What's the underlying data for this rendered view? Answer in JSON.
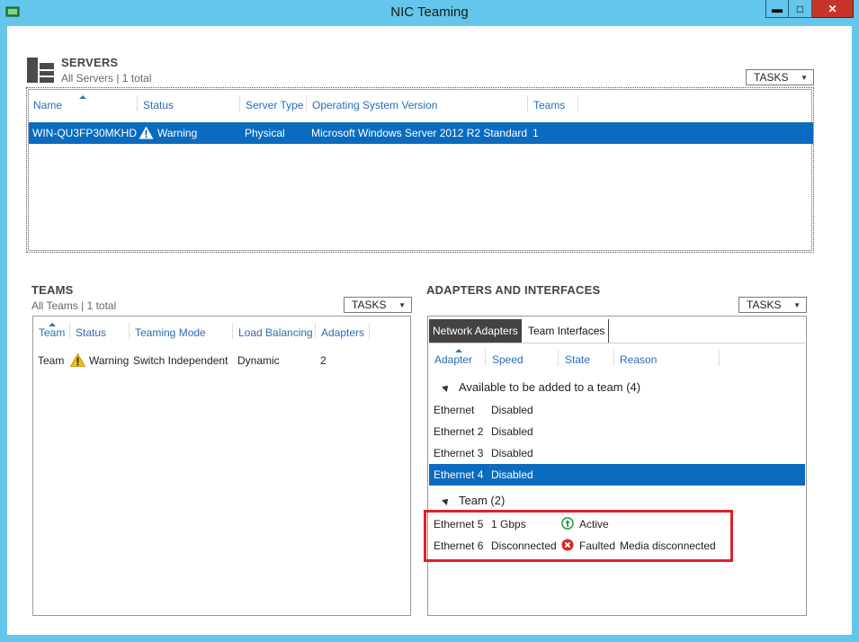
{
  "window": {
    "title": "NIC Teaming"
  },
  "window_controls": {
    "minimize": "▬",
    "maximize": "□",
    "close": "✕"
  },
  "servers": {
    "title": "SERVERS",
    "subtitle": "All Servers | 1 total",
    "tasks_label": "TASKS",
    "columns": [
      "Name",
      "Status",
      "Server Type",
      "Operating System Version",
      "Teams"
    ],
    "rows": [
      {
        "name": "WIN-QU3FP30MKHD",
        "status": "Warning",
        "server_type": "Physical",
        "os_version": "Microsoft Windows Server 2012 R2 Standard",
        "teams": "1"
      }
    ]
  },
  "teams": {
    "title": "TEAMS",
    "subtitle": "All Teams | 1 total",
    "tasks_label": "TASKS",
    "columns": [
      "Team",
      "Status",
      "Teaming Mode",
      "Load Balancing",
      "Adapters"
    ],
    "rows": [
      {
        "team": "Team",
        "status": "Warning",
        "teaming_mode": "Switch Independent",
        "load_balancing": "Dynamic",
        "adapters": "2"
      }
    ]
  },
  "adapters": {
    "title": "ADAPTERS AND INTERFACES",
    "tasks_label": "TASKS",
    "tabs": [
      "Network Adapters",
      "Team Interfaces"
    ],
    "columns": [
      "Adapter",
      "Speed",
      "State",
      "Reason"
    ],
    "groups": [
      {
        "label": "Available to be added to a team (4)",
        "rows": [
          {
            "adapter": "Ethernet",
            "speed": "Disabled",
            "state": "",
            "reason": ""
          },
          {
            "adapter": "Ethernet 2",
            "speed": "Disabled",
            "state": "",
            "reason": ""
          },
          {
            "adapter": "Ethernet 3",
            "speed": "Disabled",
            "state": "",
            "reason": ""
          },
          {
            "adapter": "Ethernet 4",
            "speed": "Disabled",
            "state": "",
            "reason": ""
          }
        ]
      },
      {
        "label": "Team (2)",
        "rows": [
          {
            "adapter": "Ethernet 5",
            "speed": "1 Gbps",
            "state": "Active",
            "reason": ""
          },
          {
            "adapter": "Ethernet 6",
            "speed": "Disconnected",
            "state": "Faulted",
            "reason": "Media disconnected"
          }
        ]
      }
    ]
  },
  "colors": {
    "frame": "#63c6ea",
    "selection": "#0b6bbf",
    "header_link": "#2b6cb5",
    "highlight": "#e0202e",
    "active_green": "#1f9a3a",
    "faulted_red": "#d42a2a",
    "warning_yellow": "#f2c200"
  }
}
